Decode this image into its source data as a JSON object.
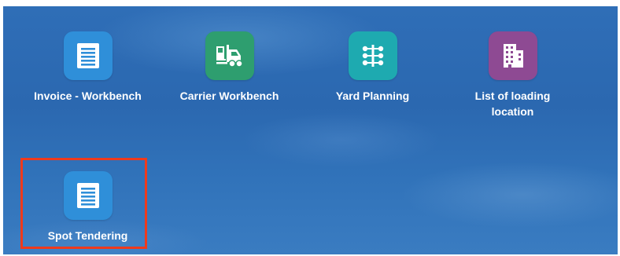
{
  "tiles": [
    {
      "label": "Invoice - Workbench",
      "icon": "document-icon",
      "color": "#2f8fd9"
    },
    {
      "label": "Carrier Workbench",
      "icon": "forklift-icon",
      "color": "#2e9e6f"
    },
    {
      "label": "Yard Planning",
      "icon": "network-icon",
      "color": "#1eaab0"
    },
    {
      "label_line1": "List of loading",
      "label_line2": "location",
      "icon": "building-icon",
      "color": "#8e4a93"
    },
    {
      "label": "Spot Tendering",
      "icon": "document-icon",
      "color": "#2f8fd9",
      "highlighted": true
    }
  ],
  "highlight_color": "#ef3a1c"
}
